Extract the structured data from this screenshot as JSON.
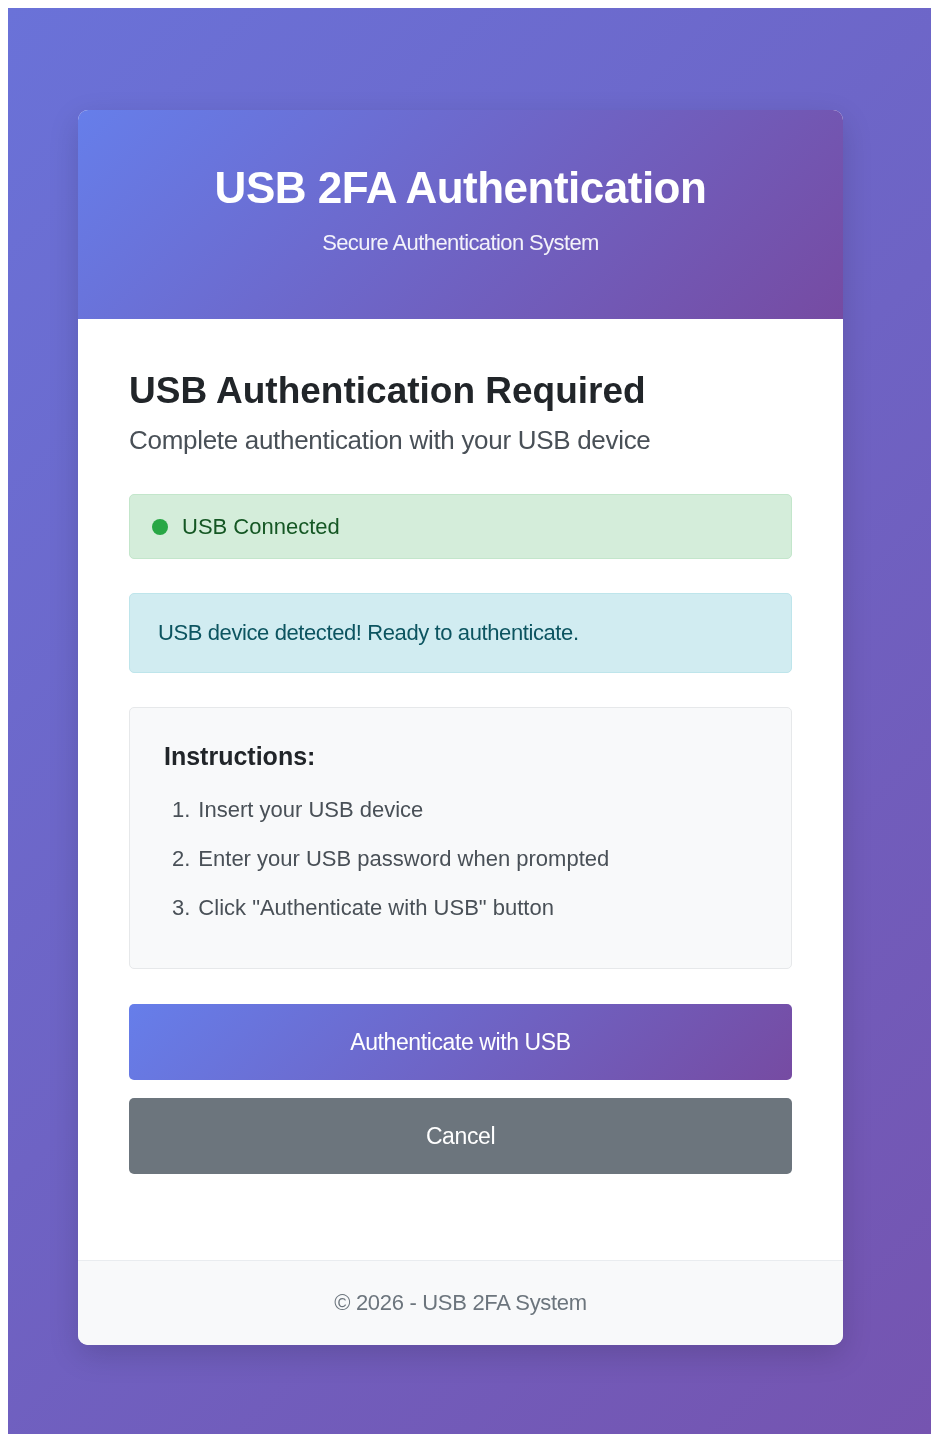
{
  "header": {
    "title": "USB 2FA Authentication",
    "subtitle": "Secure Authentication System"
  },
  "heading": "USB Authentication Required",
  "description": "Complete authentication with your USB device",
  "status": {
    "label": "USB Connected",
    "color": "#28a745"
  },
  "alert": {
    "text": "USB device detected! Ready to authenticate."
  },
  "instructions": {
    "title": "Instructions:",
    "steps": [
      {
        "number": "1.",
        "text": "Insert your USB device"
      },
      {
        "number": "2.",
        "text": "Enter your USB password when prompted"
      },
      {
        "number": "3.",
        "text": "Click \"Authenticate with USB\" button"
      }
    ]
  },
  "buttons": [
    {
      "label": "Authenticate with USB",
      "kind": "primary"
    },
    {
      "label": "Cancel",
      "kind": "secondary"
    }
  ],
  "footer": "© 2026 - USB 2FA System"
}
